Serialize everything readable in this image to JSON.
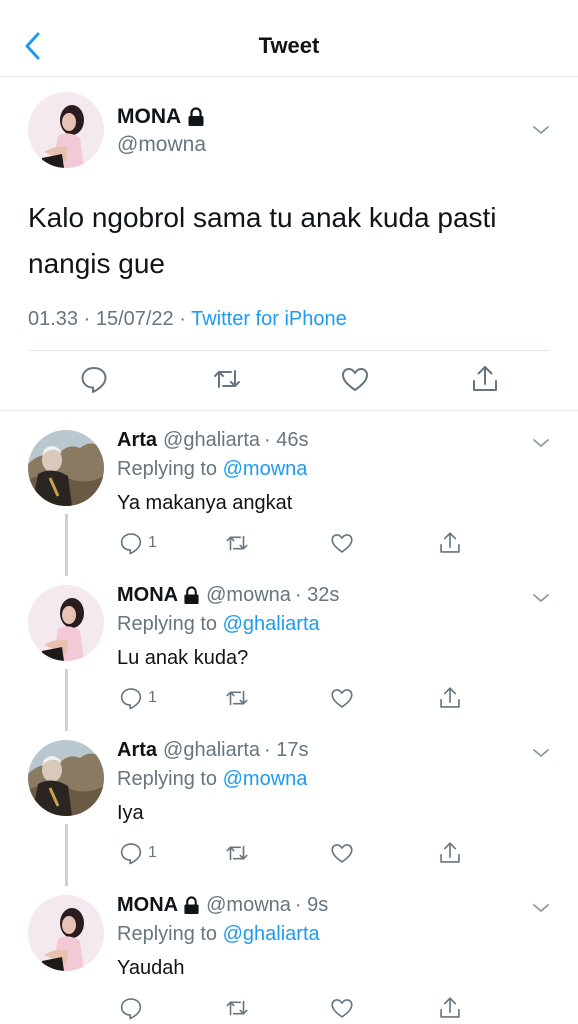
{
  "header": {
    "title": "Tweet",
    "back_icon": "chevron-left-icon"
  },
  "colors": {
    "accent": "#1d9bf0",
    "secondary_text": "#66757f",
    "divider": "#e6e9ec"
  },
  "tweet": {
    "name": "MONA",
    "handle": "@mowna",
    "protected_icon": "lock-icon",
    "text": "Kalo ngobrol sama tu anak kuda pasti nangis gue",
    "time": "01.33 · 15/07/22 · ",
    "source": "Twitter for iPhone",
    "actions": [
      "reply-icon",
      "retweet-icon",
      "like-icon",
      "share-icon"
    ]
  },
  "replies": [
    {
      "name": "Arta",
      "handle": "@ghaliarta",
      "time": "· 46s",
      "protected": false,
      "replying_prefix": "Replying to ",
      "replying_to": "@mowna",
      "text": "Ya makanya angkat",
      "reply_count": "1"
    },
    {
      "name": "MONA",
      "handle": "@mowna",
      "time": "· 32s",
      "protected": true,
      "replying_prefix": "Replying to ",
      "replying_to": "@ghaliarta",
      "text": "Lu anak kuda?",
      "reply_count": "1"
    },
    {
      "name": "Arta",
      "handle": "@ghaliarta",
      "time": "· 17s",
      "protected": false,
      "replying_prefix": "Replying to ",
      "replying_to": "@mowna",
      "text": "Iya",
      "reply_count": "1"
    },
    {
      "name": "MONA",
      "handle": "@mowna",
      "time": "· 9s",
      "protected": true,
      "replying_prefix": "Replying to ",
      "replying_to": "@ghaliarta",
      "text": "Yaudah",
      "reply_count": ""
    }
  ]
}
